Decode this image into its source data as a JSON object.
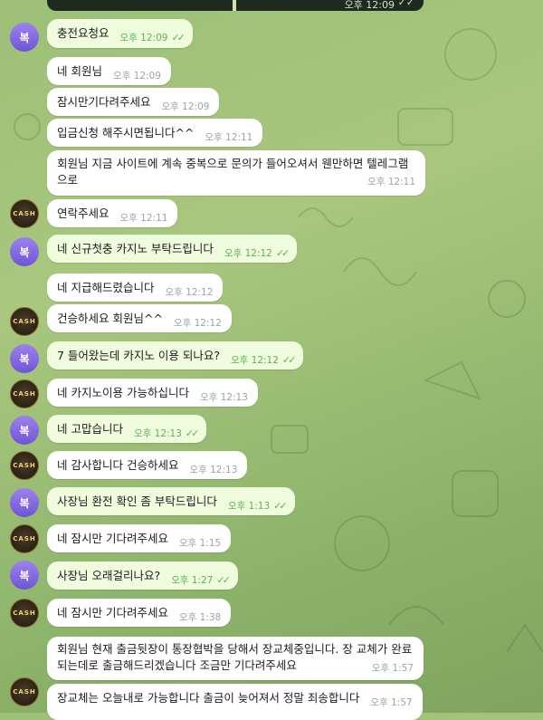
{
  "top_message": {
    "time": "오후 12:09"
  },
  "avatars": {
    "purple_initial": "복",
    "cash_label": "CASH"
  },
  "messages": [
    {
      "text": "충전요청요",
      "time": "오후 12:09"
    },
    {
      "text": "네 회원님",
      "time": "오후 12:09"
    },
    {
      "text": "잠시만기다려주세요",
      "time": "오후 12:09"
    },
    {
      "text": "입금신청 해주시면됩니다^^",
      "time": "오후 12:11"
    },
    {
      "text": "회원님 지금 사이트에 계속 중복으로 문의가 들어오셔서 웬만하면 텔레그램으로",
      "time": "오후 12:11"
    },
    {
      "text": "연락주세요",
      "time": "오후 12:11"
    },
    {
      "text": "네 신규첫충 카지노 부탁드립니다",
      "time": "오후 12:12"
    },
    {
      "text": "네 지급해드렸습니다",
      "time": "오후 12:12"
    },
    {
      "text": "건승하세요 회원님^^",
      "time": "오후 12:12"
    },
    {
      "text": "7 들어왔는데 카지노 이용 되나요?",
      "time": "오후 12:12"
    },
    {
      "text": "네 카지노이용 가능하십니다",
      "time": "오후 12:13"
    },
    {
      "text": "네 고맙습니다",
      "time": "오후 12:13"
    },
    {
      "text": "네 감사합니다 건승하세요",
      "time": "오후 12:13"
    },
    {
      "text": "사장님 환전 확인 좀 부탁드립니다",
      "time": "오후 1:13"
    },
    {
      "text": "네 잠시만 기다려주세요",
      "time": "오후 1:15"
    },
    {
      "text": "사장님 오래걸리나요?",
      "time": "오후 1:27"
    },
    {
      "text": "네 잠시만 기다려주세요",
      "time": "오후 1:38"
    },
    {
      "text": "회원님 현재 출금뒷장이 통장협박을 당해서 장교체중입니다. 장 교체가 완료되는데로 출금해드리겠습니다 조금만 기다려주세요",
      "time": "오후 1:57"
    },
    {
      "text": "장교체는 오늘내로 가능합니다 출금이 늦어져서 정말 죄송합니다",
      "time": "오후 1:57"
    }
  ],
  "colors": {
    "incoming_bubble": "#ffffff",
    "outgoing_bubble": "#effdde",
    "read_check": "#5db34f",
    "wallpaper": "#9dbf77"
  }
}
